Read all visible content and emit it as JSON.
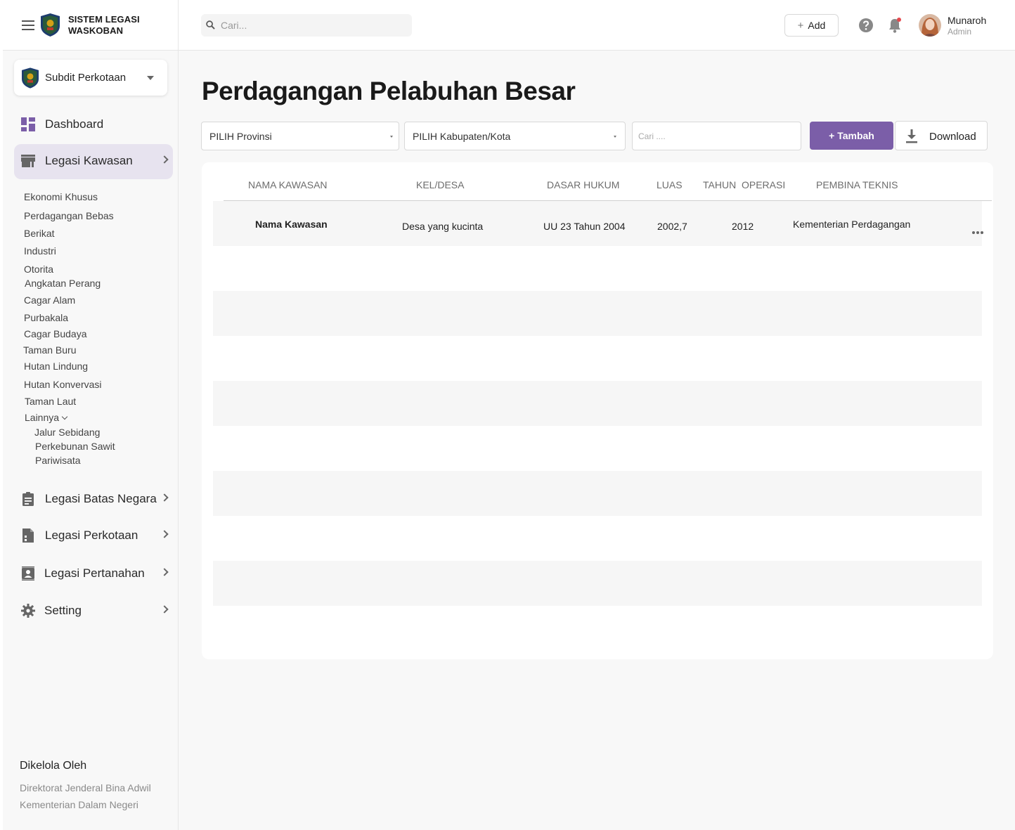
{
  "brand": {
    "title": "SISTEM LEGASI WASKOBAN"
  },
  "subdit": {
    "label": "Subdit Perkotaan"
  },
  "nav": {
    "dashboard": "Dashboard",
    "legasi_kawasan": "Legasi Kawasan",
    "legasi_batas_negara": "Legasi Batas Negara",
    "legasi_perkotaan": "Legasi Perkotaan",
    "legasi_pertanahan": "Legasi Pertanahan",
    "setting": "Setting"
  },
  "submenu": {
    "items": [
      "Ekonomi Khusus",
      "Perdagangan Bebas",
      "Berikat",
      "Industri",
      "Otorita",
      "Angkatan Perang",
      "Cagar Alam",
      "Purbakala",
      "Cagar Budaya",
      "Taman Buru",
      "Hutan Lindung",
      "Hutan Konvervasi",
      "Taman Laut",
      "Lainnya"
    ],
    "lainnya_items": [
      "Jalur Sebidang",
      "Perkebunan Sawit",
      "Pariwisata"
    ]
  },
  "footer": {
    "heading": "Dikelola Oleh",
    "line1": "Direktorat Jenderal Bina Adwil",
    "line2": "Kementerian Dalam Negeri"
  },
  "topbar": {
    "search_placeholder": "Cari...",
    "add_label": "Add",
    "user_name": "Munaroh",
    "user_role": "Admin"
  },
  "page": {
    "title": "Perdagangan Pelabuhan Besar",
    "provinsi_select": "PILIH Provinsi",
    "kabupaten_select": "PILIH Kabupaten/Kota",
    "cari_placeholder": "Cari ....",
    "tambah_label": "+ Tambah",
    "download_label": "Download"
  },
  "table": {
    "headers": [
      "NAMA KAWASAN",
      "KEL/DESA",
      "DASAR HUKUM",
      "LUAS",
      "TAHUN  OPERASI",
      "PEMBINA TEKNIS"
    ],
    "rows": [
      {
        "nama": "Nama Kawasan",
        "desa": "Desa yang kucinta",
        "dasar": "UU 23 Tahun 2004",
        "luas": "2002,7",
        "tahun": "2012",
        "pembina": "Kementerian Perdagangan"
      }
    ]
  },
  "colors": {
    "accent": "#7b5ea8",
    "active_nav_bg": "#e7e3ef",
    "notification_dot": "#e5484d"
  },
  "icons": [
    "hamburger-icon",
    "search-icon",
    "plus-icon",
    "help-icon",
    "bell-icon",
    "dashboard-icon",
    "store-icon",
    "clipboard-icon",
    "document-icon",
    "contact-icon",
    "gear-icon",
    "download-icon",
    "more-icon"
  ]
}
